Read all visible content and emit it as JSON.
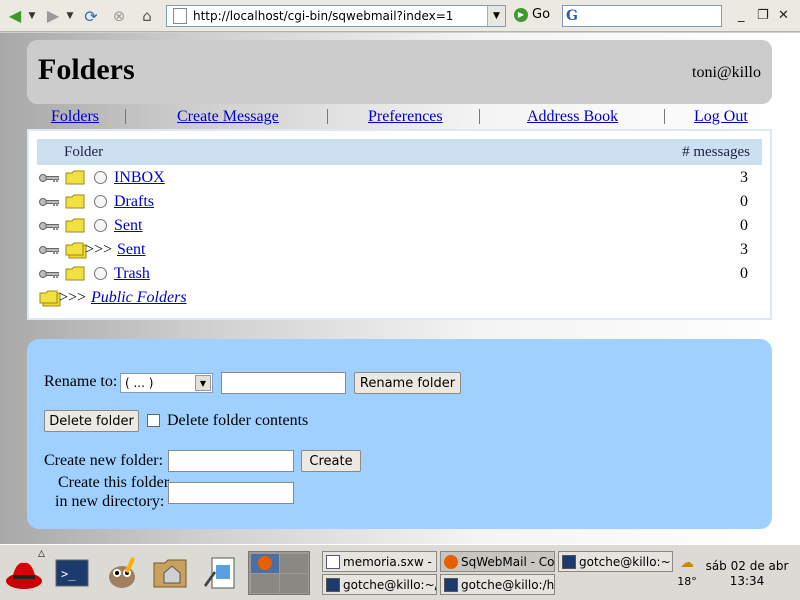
{
  "browser": {
    "url": "http://localhost/cgi-bin/sqwebmail?index=1",
    "go_label": "Go",
    "search_value": ""
  },
  "header": {
    "title": "Folders",
    "user": "toni@killo"
  },
  "nav": {
    "items": [
      {
        "label": "Folders"
      },
      {
        "label": "Create Message"
      },
      {
        "label": "Preferences"
      },
      {
        "label": "Address Book"
      },
      {
        "label": "Log Out"
      }
    ]
  },
  "folders": {
    "col_folder": "Folder",
    "col_count": "# messages",
    "rows": [
      {
        "name": "INBOX",
        "count": "3",
        "prefix": ""
      },
      {
        "name": "Drafts",
        "count": "0",
        "prefix": ""
      },
      {
        "name": "Sent",
        "count": "0",
        "prefix": ""
      },
      {
        "name": "Sent",
        "count": "3",
        "prefix": ">>>"
      },
      {
        "name": "Trash",
        "count": "0",
        "prefix": ""
      }
    ],
    "public": {
      "prefix": ">>>",
      "name": "Public Folders"
    }
  },
  "actions": {
    "rename_label": "Rename to:",
    "rename_select_value": "( ... )",
    "rename_input_value": "",
    "rename_button": "Rename folder",
    "delete_button": "Delete folder",
    "delete_contents_label": "Delete folder contents",
    "create_label": "Create new folder:",
    "create_input_value": "",
    "create_button": "Create",
    "create_dir_label_1": "Create this folder",
    "create_dir_label_2": "in new directory:",
    "create_dir_input_value": ""
  },
  "taskbar": {
    "tasks": [
      {
        "label": "memoria.sxw - O"
      },
      {
        "label": "SqWebMail - Co"
      },
      {
        "label": "gotche@killo:~"
      },
      {
        "label": "gotche@killo:~/e"
      },
      {
        "label": "gotche@killo:/ho"
      }
    ],
    "temperature": "18°",
    "date": "sáb 02 de abr",
    "time": "13:34"
  },
  "colors": {
    "header_bg": "#cccccc",
    "link": "#0000cc",
    "table_header_bg": "#cde0f2",
    "actions_bg": "#9fd0ff"
  }
}
